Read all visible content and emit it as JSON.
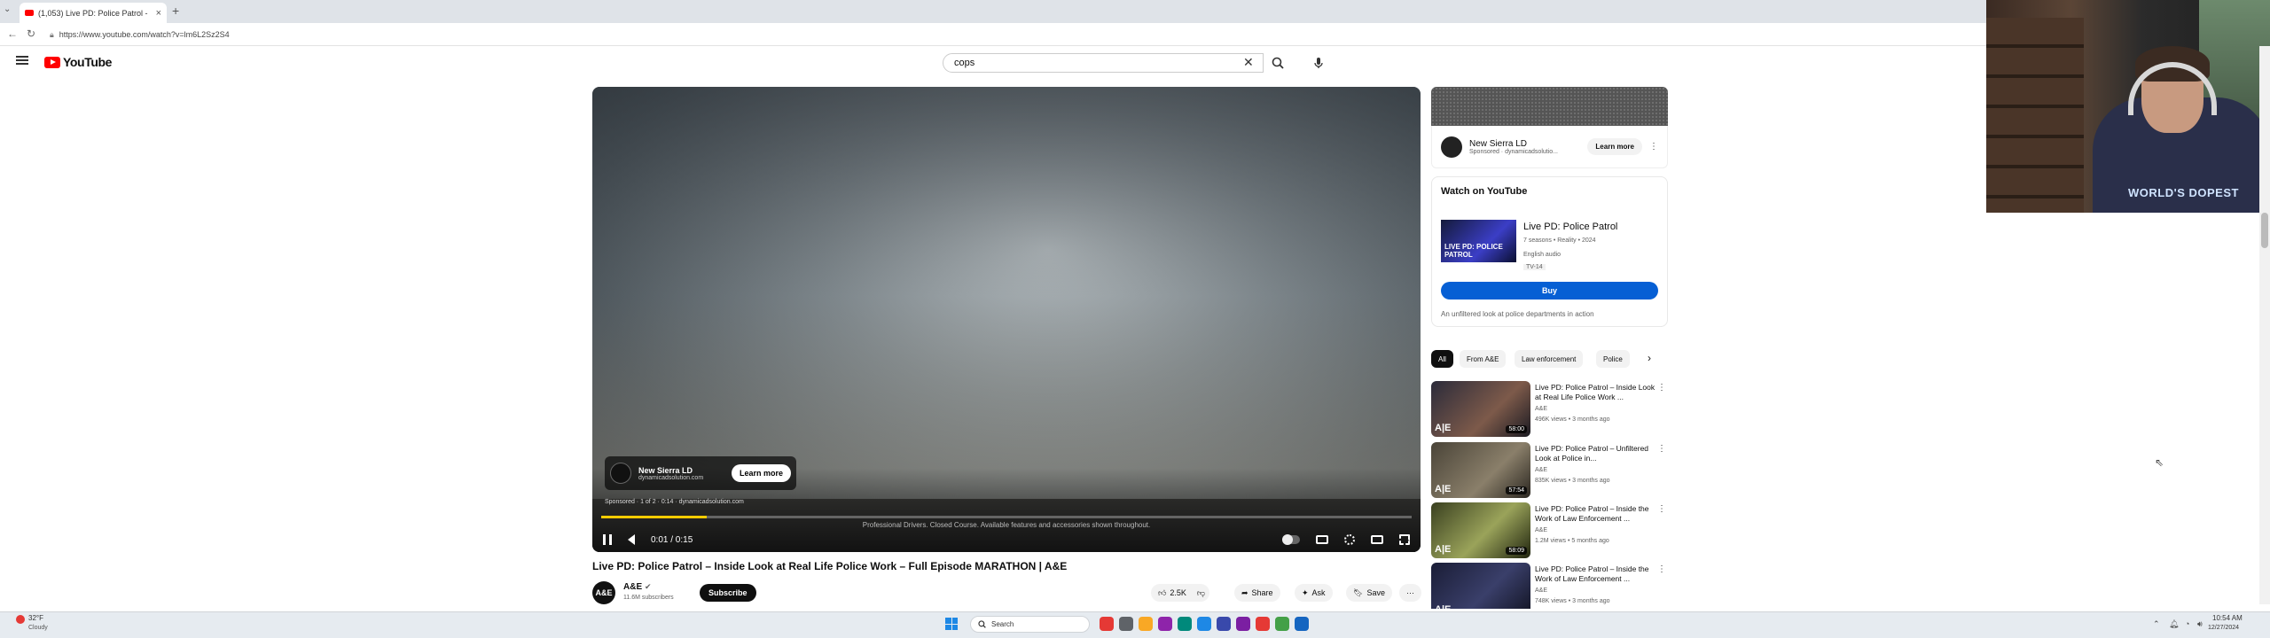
{
  "browser": {
    "tab_title": "(1,053) Live PD: Police Patrol -",
    "url": "https://www.youtube.com/watch?v=lm6L2Sz2S4",
    "new_tab": "+",
    "tab_close": "×"
  },
  "youtube": {
    "logo_text": "YouTube",
    "search_query": "cops",
    "clear_glyph": "✕"
  },
  "player": {
    "ad": {
      "advertiser": "New Sierra LD",
      "domain": "dynamicadsolution.com",
      "learn_more": "Learn more",
      "sponsored_line": "Sponsored · 1 of 2 · 0:14 · dynamicadsolution.com",
      "disclaimer": "Professional Drivers. Closed Course. Available features and accessories shown throughout."
    },
    "time": "0:01 / 0:15",
    "progress_fraction": 0.13
  },
  "video": {
    "title": "Live PD: Police Patrol – Inside Look at Real Life Police Work – Full Episode MARATHON | A&E",
    "channel": "A&E",
    "avatar_text": "A&E",
    "verified": "✔",
    "subscribers": "11.6M subscribers",
    "subscribe_label": "Subscribe",
    "likes": "2.5K",
    "share": "Share",
    "ask": "Ask",
    "save": "Save",
    "more": "···"
  },
  "sidebar_ad": {
    "advertiser": "New Sierra LD",
    "sponsored": "Sponsored · dynamicadsolutio...",
    "learn_more": "Learn more"
  },
  "watch_on": {
    "heading": "Watch on YouTube",
    "thumb_text": "LIVE PD: POLICE PATROL",
    "show": "Live PD: Police Patrol",
    "meta": "7 seasons • Reality • 2024",
    "language": "English audio",
    "rating": "TV-14",
    "buy_label": "Buy",
    "description": "An unfiltered look at police departments in action"
  },
  "chips": [
    "All",
    "From A&E",
    "Law enforcement",
    "Police"
  ],
  "recommendations": [
    {
      "title": "Live PD: Police Patrol – Inside Look at Real Life Police Work ...",
      "channel": "A&E",
      "meta": "496K views • 3 months ago",
      "duration": "58:00",
      "thumb_color": "#7d5a4a"
    },
    {
      "title": "Live PD: Police Patrol – Unfiltered Look at Police in...",
      "channel": "A&E",
      "meta": "835K views • 3 months ago",
      "duration": "57:54",
      "thumb_color": "#8a7f6a"
    },
    {
      "title": "Live PD: Police Patrol – Inside the Work of Law Enforcement ...",
      "channel": "A&E",
      "meta": "1.2M views • 5 months ago",
      "duration": "58:09",
      "thumb_color": "#9aa35a"
    },
    {
      "title": "Live PD: Police Patrol – Inside the Work of Law Enforcement ...",
      "channel": "A&E",
      "meta": "748K views • 3 months ago",
      "duration": "",
      "thumb_color": "#3a3f6a"
    }
  ],
  "webcam": {
    "shirt_text": "WORLD'S DOPEST"
  },
  "taskbar": {
    "weather_temp": "32°F",
    "weather_cond": "Cloudy",
    "search_placeholder": "Search",
    "time": "10:54 AM",
    "date": "12/27/2024",
    "apps": [
      "#e53935",
      "#5f6368",
      "#f9a825",
      "#8e24aa",
      "#00897b",
      "#1e88e5",
      "#3949ab",
      "#7b1fa2",
      "#e53935",
      "#43a047",
      "#1565c0"
    ]
  }
}
